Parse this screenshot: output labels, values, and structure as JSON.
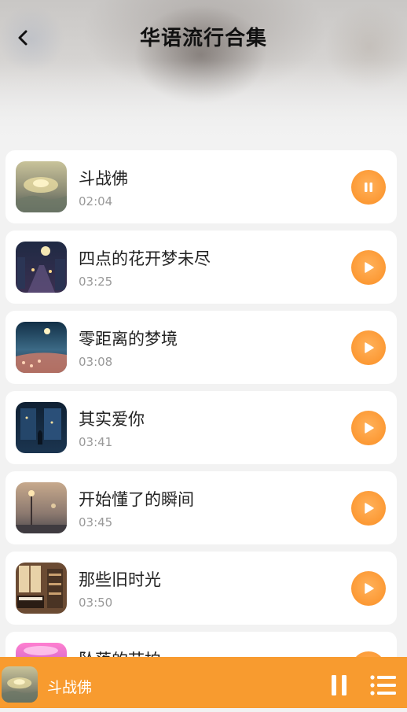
{
  "header": {
    "title": "华语流行合集",
    "back_icon": "back-arrow-icon"
  },
  "songs": [
    {
      "name": "斗战佛",
      "duration": "02:04",
      "state": "playing",
      "art": "mist-mountain"
    },
    {
      "name": "四点的花开梦未尽",
      "duration": "03:25",
      "state": "paused",
      "art": "night-street"
    },
    {
      "name": "零距离的梦境",
      "duration": "03:08",
      "state": "paused",
      "art": "moon-shore"
    },
    {
      "name": "其实爱你",
      "duration": "03:41",
      "state": "paused",
      "art": "night-window"
    },
    {
      "name": "开始懂了的瞬间",
      "duration": "03:45",
      "state": "paused",
      "art": "foggy-lamp"
    },
    {
      "name": "那些旧时光",
      "duration": "03:50",
      "state": "paused",
      "art": "piano-room"
    },
    {
      "name": "坠落的节拍",
      "duration": "",
      "state": "paused",
      "art": "pink-glow"
    }
  ],
  "player": {
    "title": "斗战佛",
    "pause_icon": "pause-icon",
    "playlist_icon": "playlist-icon"
  },
  "colors": {
    "accent": "#f89b2f",
    "button": "#fb8f24",
    "background": "#f2f2f2"
  }
}
